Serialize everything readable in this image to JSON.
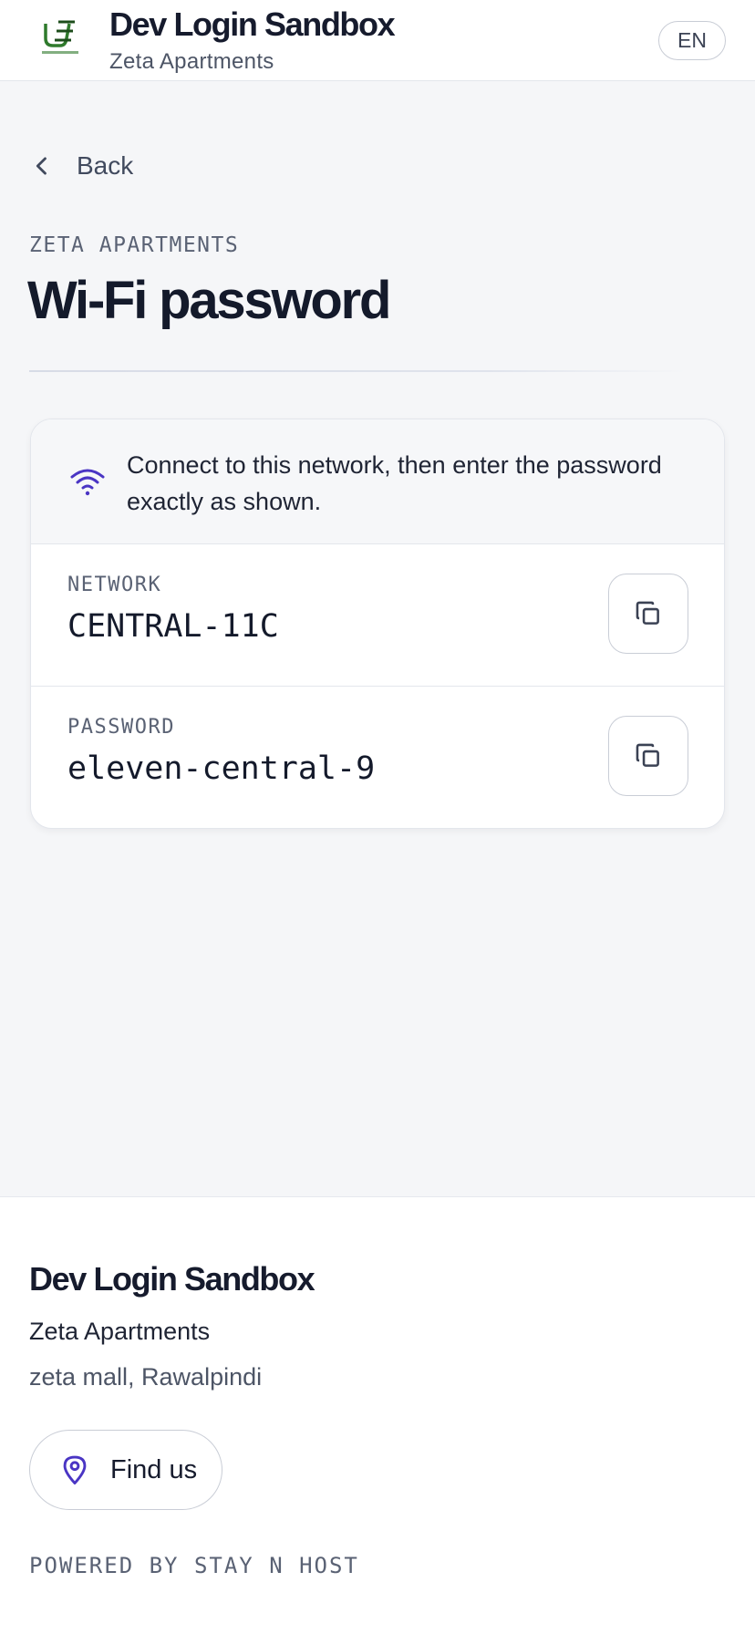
{
  "header": {
    "brand_title": "Dev Login Sandbox",
    "brand_subtitle": "Zeta Apartments",
    "language": "EN",
    "logo_icon": "urban-elan-logo"
  },
  "nav": {
    "back_label": "Back"
  },
  "page": {
    "eyebrow": "ZETA APARTMENTS",
    "title": "Wi-Fi password"
  },
  "wifi_card": {
    "notice": "Connect to this network, then enter the password exactly as shown.",
    "network_label": "NETWORK",
    "network_value": "CENTRAL-11C",
    "password_label": "PASSWORD",
    "password_value": "eleven-central-9"
  },
  "footer": {
    "title": "Dev Login Sandbox",
    "property_name": "Zeta Apartments",
    "address": "zeta mall, Rawalpindi",
    "find_us_label": "Find us",
    "powered_by": "POWERED BY STAY N HOST"
  },
  "colors": {
    "accent": "#4a35c4",
    "background": "#f5f6f8",
    "text": "#141a2b",
    "logo_green": "#2f7a2c"
  }
}
